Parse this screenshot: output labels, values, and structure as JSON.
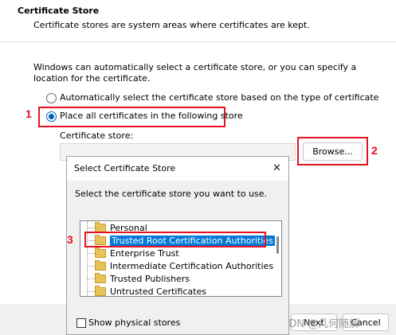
{
  "header": {
    "title": "Certificate Store",
    "subtitle": "Certificate stores are system areas where certificates are kept."
  },
  "main": {
    "intro": "Windows can automatically select a certificate store, or you can specify a location for the certificate.",
    "auto_option": "Automatically select the certificate store based on the type of certificate",
    "place_option": "Place all certificates in the following store",
    "store_label": "Certificate store:",
    "browse_label": "Browse..."
  },
  "annotations": {
    "n1": "1",
    "n2": "2",
    "n3": "3"
  },
  "dialog": {
    "title": "Select Certificate Store",
    "close_glyph": "✕",
    "prompt": "Select the certificate store you want to use.",
    "stores": [
      "Personal",
      "Trusted Root Certification Authorities",
      "Enterprise Trust",
      "Intermediate Certification Authorities",
      "Trusted Publishers",
      "Untrusted Certificates"
    ],
    "show_physical_label": "Show physical stores"
  },
  "footer": {
    "next_label": "Next",
    "cancel_label": "Cancel",
    "watermark": "CSDN @几何随解"
  },
  "colors": {
    "accent": "#005fb8",
    "annotation": "#e81123",
    "selection": "#0078d7"
  }
}
